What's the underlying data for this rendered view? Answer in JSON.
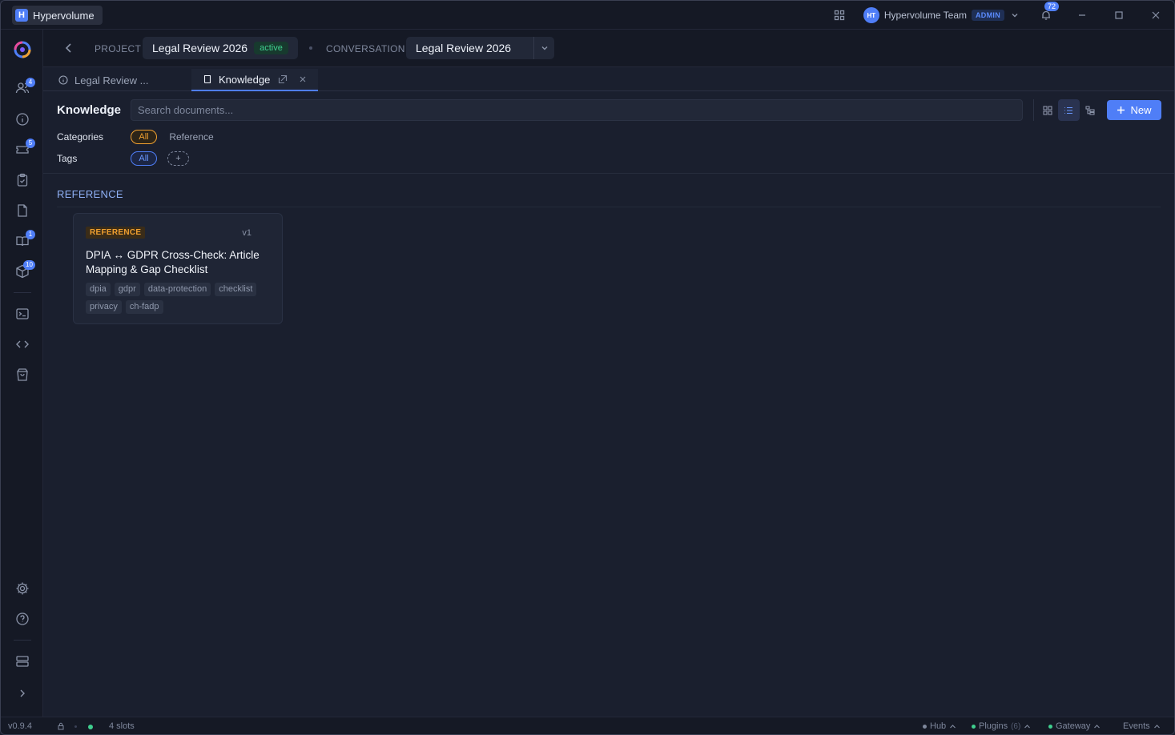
{
  "app": {
    "logo_letter": "H",
    "name": "Hypervolume"
  },
  "titlebar": {
    "team_initials": "HT",
    "team_name": "Hypervolume Team",
    "role_badge": "ADMIN",
    "notification_count": "72"
  },
  "rail": {
    "badges": {
      "members": "4",
      "tickets": "5",
      "knowledge": "1",
      "packages": "10"
    }
  },
  "breadcrumb": {
    "project_label": "PROJECT",
    "project_name": "Legal Review 2026",
    "project_status": "active",
    "conversation_label": "CONVERSATION",
    "conversation_name": "Legal Review 2026"
  },
  "tabs": [
    {
      "label": "Legal Review ..."
    },
    {
      "label": "Knowledge"
    }
  ],
  "knowledge": {
    "title": "Knowledge",
    "search_placeholder": "Search documents...",
    "new_label": "New",
    "categories_label": "Categories",
    "categories": [
      "All",
      "Reference"
    ],
    "tags_label": "Tags",
    "tags_filter": [
      "All"
    ],
    "add_tag": "+"
  },
  "section": {
    "heading": "REFERENCE"
  },
  "documents": [
    {
      "category": "REFERENCE",
      "version": "v1",
      "title": "DPIA ↔ GDPR Cross-Check: Article Mapping & Gap Checklist",
      "tags": [
        "dpia",
        "gdpr",
        "data-protection",
        "checklist",
        "privacy",
        "ch-fadp"
      ]
    }
  ],
  "statusbar": {
    "version": "v0.9.4",
    "slots": "4 slots",
    "hub": "Hub",
    "plugins": "Plugins",
    "plugins_count": "(6)",
    "gateway": "Gateway",
    "events": "Events"
  },
  "colors": {
    "accent": "#4f7ef7",
    "active_green": "#3fcf8e",
    "reference_orange": "#f0a030"
  }
}
